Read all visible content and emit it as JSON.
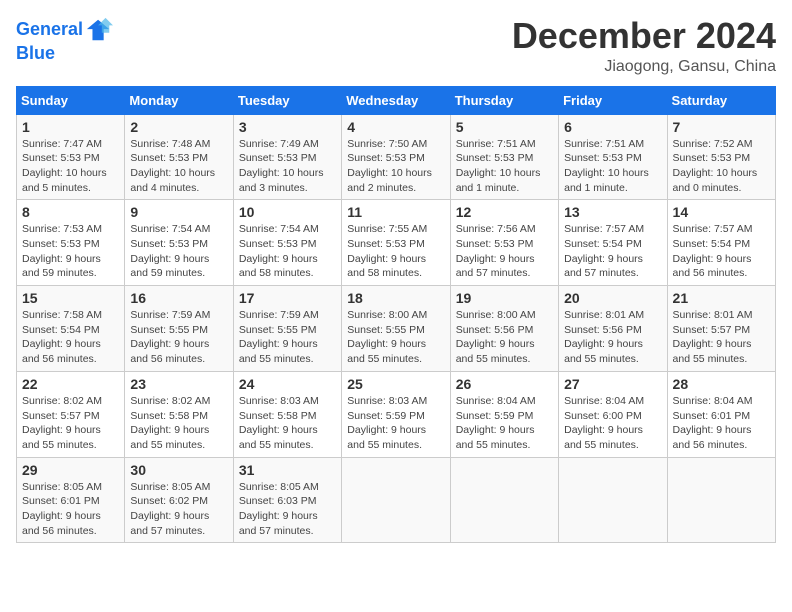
{
  "logo": {
    "line1": "General",
    "line2": "Blue"
  },
  "title": "December 2024",
  "subtitle": "Jiaogong, Gansu, China",
  "days_of_week": [
    "Sunday",
    "Monday",
    "Tuesday",
    "Wednesday",
    "Thursday",
    "Friday",
    "Saturday"
  ],
  "weeks": [
    [
      {
        "day": 1,
        "sunrise": "7:47 AM",
        "sunset": "5:53 PM",
        "daylight": "10 hours and 5 minutes."
      },
      {
        "day": 2,
        "sunrise": "7:48 AM",
        "sunset": "5:53 PM",
        "daylight": "10 hours and 4 minutes."
      },
      {
        "day": 3,
        "sunrise": "7:49 AM",
        "sunset": "5:53 PM",
        "daylight": "10 hours and 3 minutes."
      },
      {
        "day": 4,
        "sunrise": "7:50 AM",
        "sunset": "5:53 PM",
        "daylight": "10 hours and 2 minutes."
      },
      {
        "day": 5,
        "sunrise": "7:51 AM",
        "sunset": "5:53 PM",
        "daylight": "10 hours and 1 minute."
      },
      {
        "day": 6,
        "sunrise": "7:51 AM",
        "sunset": "5:53 PM",
        "daylight": "10 hours and 1 minute."
      },
      {
        "day": 7,
        "sunrise": "7:52 AM",
        "sunset": "5:53 PM",
        "daylight": "10 hours and 0 minutes."
      }
    ],
    [
      {
        "day": 8,
        "sunrise": "7:53 AM",
        "sunset": "5:53 PM",
        "daylight": "9 hours and 59 minutes."
      },
      {
        "day": 9,
        "sunrise": "7:54 AM",
        "sunset": "5:53 PM",
        "daylight": "9 hours and 59 minutes."
      },
      {
        "day": 10,
        "sunrise": "7:54 AM",
        "sunset": "5:53 PM",
        "daylight": "9 hours and 58 minutes."
      },
      {
        "day": 11,
        "sunrise": "7:55 AM",
        "sunset": "5:53 PM",
        "daylight": "9 hours and 58 minutes."
      },
      {
        "day": 12,
        "sunrise": "7:56 AM",
        "sunset": "5:53 PM",
        "daylight": "9 hours and 57 minutes."
      },
      {
        "day": 13,
        "sunrise": "7:57 AM",
        "sunset": "5:54 PM",
        "daylight": "9 hours and 57 minutes."
      },
      {
        "day": 14,
        "sunrise": "7:57 AM",
        "sunset": "5:54 PM",
        "daylight": "9 hours and 56 minutes."
      }
    ],
    [
      {
        "day": 15,
        "sunrise": "7:58 AM",
        "sunset": "5:54 PM",
        "daylight": "9 hours and 56 minutes."
      },
      {
        "day": 16,
        "sunrise": "7:59 AM",
        "sunset": "5:55 PM",
        "daylight": "9 hours and 56 minutes."
      },
      {
        "day": 17,
        "sunrise": "7:59 AM",
        "sunset": "5:55 PM",
        "daylight": "9 hours and 55 minutes."
      },
      {
        "day": 18,
        "sunrise": "8:00 AM",
        "sunset": "5:55 PM",
        "daylight": "9 hours and 55 minutes."
      },
      {
        "day": 19,
        "sunrise": "8:00 AM",
        "sunset": "5:56 PM",
        "daylight": "9 hours and 55 minutes."
      },
      {
        "day": 20,
        "sunrise": "8:01 AM",
        "sunset": "5:56 PM",
        "daylight": "9 hours and 55 minutes."
      },
      {
        "day": 21,
        "sunrise": "8:01 AM",
        "sunset": "5:57 PM",
        "daylight": "9 hours and 55 minutes."
      }
    ],
    [
      {
        "day": 22,
        "sunrise": "8:02 AM",
        "sunset": "5:57 PM",
        "daylight": "9 hours and 55 minutes."
      },
      {
        "day": 23,
        "sunrise": "8:02 AM",
        "sunset": "5:58 PM",
        "daylight": "9 hours and 55 minutes."
      },
      {
        "day": 24,
        "sunrise": "8:03 AM",
        "sunset": "5:58 PM",
        "daylight": "9 hours and 55 minutes."
      },
      {
        "day": 25,
        "sunrise": "8:03 AM",
        "sunset": "5:59 PM",
        "daylight": "9 hours and 55 minutes."
      },
      {
        "day": 26,
        "sunrise": "8:04 AM",
        "sunset": "5:59 PM",
        "daylight": "9 hours and 55 minutes."
      },
      {
        "day": 27,
        "sunrise": "8:04 AM",
        "sunset": "6:00 PM",
        "daylight": "9 hours and 55 minutes."
      },
      {
        "day": 28,
        "sunrise": "8:04 AM",
        "sunset": "6:01 PM",
        "daylight": "9 hours and 56 minutes."
      }
    ],
    [
      {
        "day": 29,
        "sunrise": "8:05 AM",
        "sunset": "6:01 PM",
        "daylight": "9 hours and 56 minutes."
      },
      {
        "day": 30,
        "sunrise": "8:05 AM",
        "sunset": "6:02 PM",
        "daylight": "9 hours and 57 minutes."
      },
      {
        "day": 31,
        "sunrise": "8:05 AM",
        "sunset": "6:03 PM",
        "daylight": "9 hours and 57 minutes."
      },
      null,
      null,
      null,
      null
    ]
  ]
}
